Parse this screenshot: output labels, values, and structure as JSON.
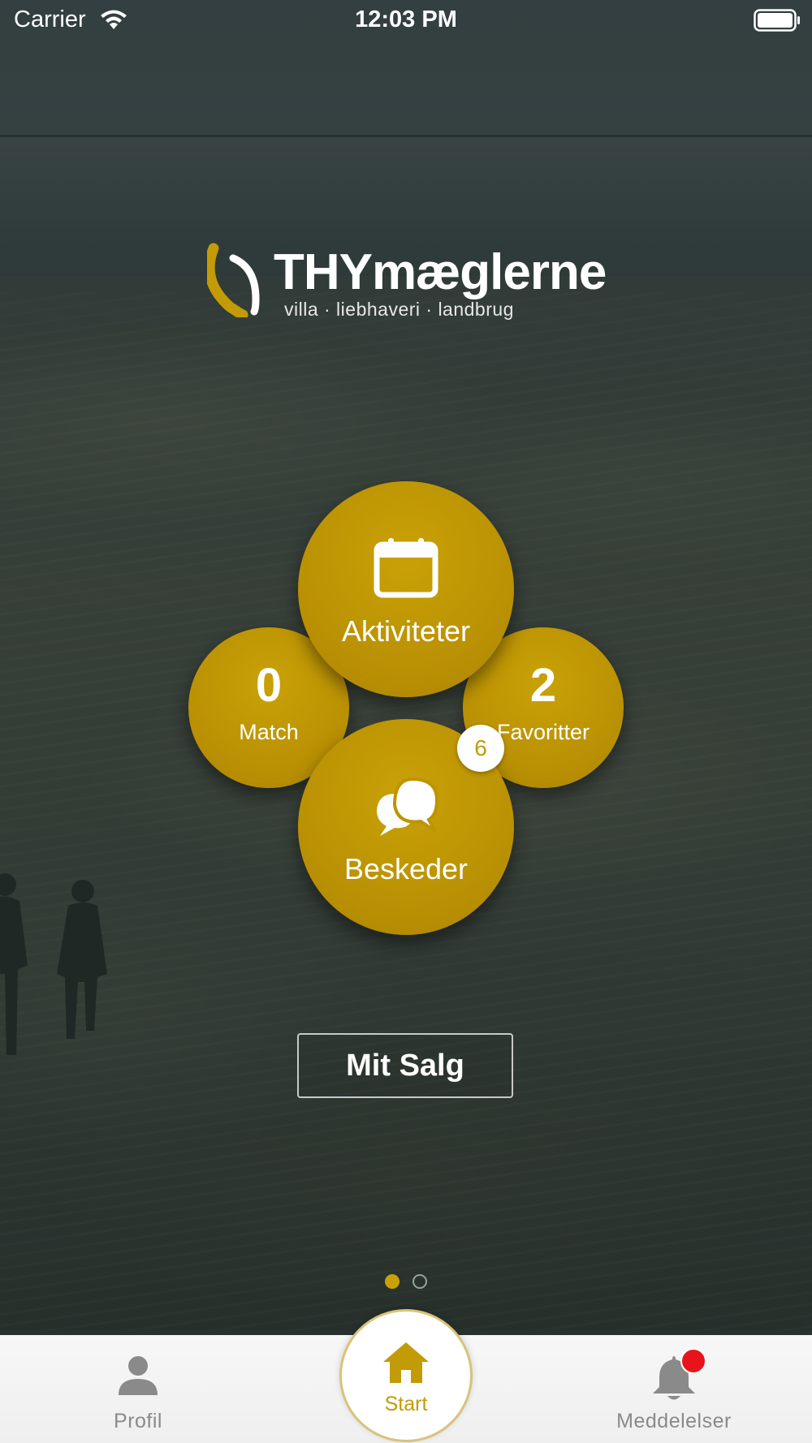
{
  "status_bar": {
    "carrier": "Carrier",
    "time": "12:03 PM"
  },
  "logo": {
    "name": "THYmæglerne",
    "tagline": "villa · liebhaveri · landbrug"
  },
  "tiles": {
    "match": {
      "count": "0",
      "label": "Match"
    },
    "favoritter": {
      "count": "2",
      "label": "Favoritter"
    },
    "aktiviteter": {
      "label": "Aktiviteter",
      "icon": "calendar-icon"
    },
    "beskeder": {
      "label": "Beskeder",
      "icon": "chat-bubbles-icon",
      "badge": "6"
    }
  },
  "mit_salg_label": "Mit Salg",
  "pager": {
    "pages": 2,
    "active": 1
  },
  "tab_bar": {
    "profil": {
      "label": "Profil",
      "icon": "person-icon"
    },
    "start": {
      "label": "Start",
      "icon": "home-icon"
    },
    "meddelelser": {
      "label": "Meddelelser",
      "icon": "bell-icon",
      "has_notification": true
    }
  },
  "colors": {
    "accent": "#c29b06",
    "notification": "#e8141b"
  }
}
